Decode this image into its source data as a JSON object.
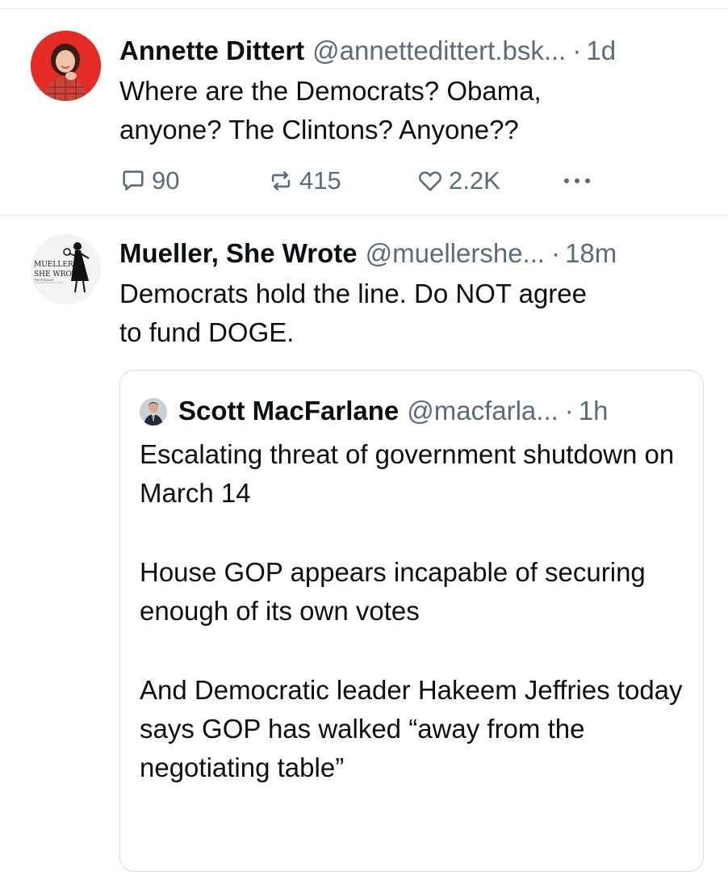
{
  "posts": [
    {
      "display_name": "Annette Dittert",
      "handle": "@annettedittert.bsk...",
      "separator": "·",
      "time": "1d",
      "text": "Where are the Democrats? Obama,\nanyone? The Clintons? Anyone??",
      "reply_count": "90",
      "repost_count": "415",
      "like_count": "2.2K",
      "more_label": "•••"
    },
    {
      "display_name": "Mueller, She Wrote",
      "handle": "@muellershe...",
      "separator": "·",
      "time": "18m",
      "text": "Democrats hold the line. Do NOT agree\nto fund DOGE.",
      "avatar_logo_text": "MUELLER, SHE WROTE",
      "quote": {
        "display_name": "Scott MacFarlane",
        "handle": "@macfarla...",
        "separator": "·",
        "time": "1h",
        "paragraphs": [
          "Escalating threat of government shutdown on March 14",
          "House GOP appears incapable of securing enough of its own votes",
          "And Democratic leader Hakeem Jeffries today says GOP has walked “away from the negotiating table”"
        ]
      }
    }
  ],
  "colors": {
    "text_primary": "#0b0f14",
    "text_secondary": "#5b6b7a",
    "divider": "#e6e9ec",
    "avatar_bg_red": "#e42b25"
  },
  "icons": {
    "reply": "reply-icon",
    "repost": "repost-icon",
    "like": "heart-icon",
    "more": "more-dots-icon"
  }
}
